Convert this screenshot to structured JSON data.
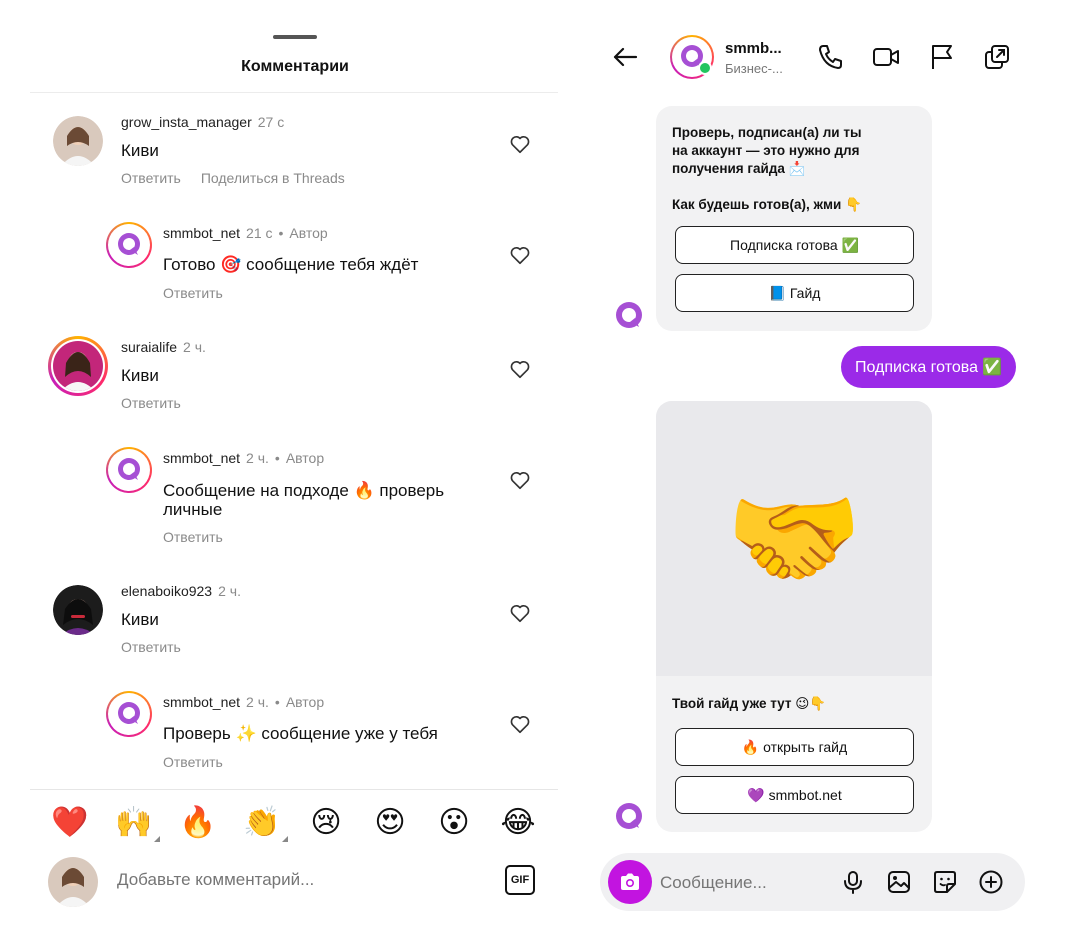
{
  "comments_panel": {
    "title": "Комментарии",
    "comments": [
      {
        "username": "grow_insta_manager",
        "time": "27 с",
        "author_tag": "",
        "text": "Киви",
        "reply": "Ответить",
        "share": "Поделиться в Threads"
      },
      {
        "username": "smmbot_net",
        "time": "21 с",
        "author_tag": "Автор",
        "text": "Готово 🎯 сообщение тебя ждёт",
        "reply": "Ответить"
      },
      {
        "username": "suraialife",
        "time": "2 ч.",
        "author_tag": "",
        "text": "Киви",
        "reply": "Ответить"
      },
      {
        "username": "smmbot_net",
        "time": "2 ч.",
        "author_tag": "Автор",
        "text": "Сообщение на подходе 🔥 проверь личные",
        "reply": "Ответить"
      },
      {
        "username": "elenaboiko923",
        "time": "2 ч.",
        "author_tag": "",
        "text": "Киви",
        "reply": "Ответить"
      },
      {
        "username": "smmbot_net",
        "time": "2 ч.",
        "author_tag": "Автор",
        "text": "Проверь ✨ сообщение уже у тебя",
        "reply": "Ответить"
      }
    ],
    "emoji_bar": [
      "❤️",
      "🙌",
      "🔥",
      "👏",
      "😢",
      "😍",
      "😮",
      "😂"
    ],
    "compose_placeholder": "Добавьте комментарий...",
    "gif_label": "GIF"
  },
  "chat": {
    "name": "smmb...",
    "subtitle": "Бизнес-...",
    "first_message": {
      "line1": "Проверь, подписан(а) ли ты",
      "line2": "на аккаунт — это нужно для",
      "line3": "получения гайда 📩",
      "line4": "Как будешь готов(а), жми 👇",
      "btn1": "Подписка готова ✅",
      "btn2": "📘 Гайд"
    },
    "my_message": "Подписка готова ✅",
    "image_emoji": "🤝",
    "second_message": {
      "text": "Твой гайд уже тут 😉👇",
      "btn1": "🔥 открыть гайд",
      "btn2": "💜 smmbot.net"
    },
    "input_placeholder": "Сообщение..."
  },
  "colors": {
    "accent_purple": "#9b2ae8",
    "camera_magenta": "#c214e0",
    "online_green": "#22c55e"
  }
}
